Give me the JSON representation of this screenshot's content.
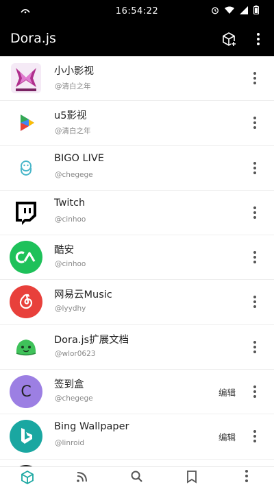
{
  "status_bar": {
    "time": "16:54:22"
  },
  "app_bar": {
    "title": "Dora.js"
  },
  "list": [
    {
      "name": "小小影视",
      "author": "@清白之年",
      "avatar_color": "#f3e8f5",
      "edit": ""
    },
    {
      "name": "u5影视",
      "author": "@清白之年",
      "avatar_color": "#ffffff",
      "edit": ""
    },
    {
      "name": "BIGO LIVE",
      "author": "@chegege",
      "avatar_color": "#ffffff",
      "edit": ""
    },
    {
      "name": "Twitch",
      "author": "@cinhoo",
      "avatar_color": "#ffffff",
      "edit": ""
    },
    {
      "name": "酷安",
      "author": "@cinhoo",
      "avatar_color": "#1ec15a",
      "edit": ""
    },
    {
      "name": "网易云Music",
      "author": "@lyydhy",
      "avatar_color": "#e8403b",
      "edit": ""
    },
    {
      "name": "Dora.js扩展文档",
      "author": "@wlor0623",
      "avatar_color": "#ffffff",
      "edit": ""
    },
    {
      "name": "签到盒",
      "author": "@chegege",
      "avatar_color": "#9c7fe3",
      "avatar_letter": "C",
      "edit": "编辑"
    },
    {
      "name": "Bing Wallpaper",
      "author": "@linroid",
      "avatar_color": "#1aa7a1",
      "edit": "编辑"
    }
  ],
  "bottom_nav": [
    {
      "name": "extensions",
      "active": true
    },
    {
      "name": "feeds"
    },
    {
      "name": "search"
    },
    {
      "name": "bookmarks"
    },
    {
      "name": "more"
    }
  ]
}
